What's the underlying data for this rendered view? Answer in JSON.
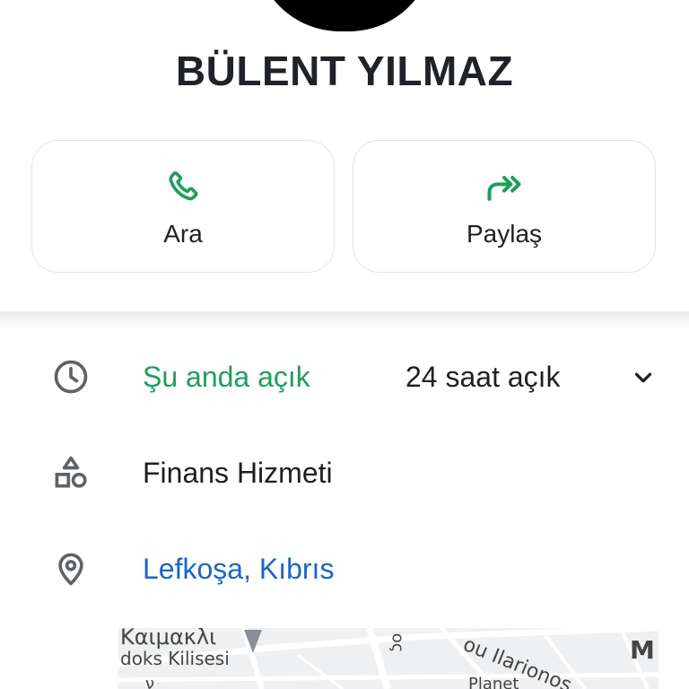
{
  "profile": {
    "name": "BÜLENT YILMAZ"
  },
  "actions": {
    "call_label": "Ara",
    "share_label": "Paylaş"
  },
  "info": {
    "open_status": "Şu anda açık",
    "hours": "24 saat açık",
    "category": "Finans Hizmeti",
    "location": "Lefkoşa, Kıbrıs"
  },
  "map": {
    "label_kaimakli": "Καιμακλι",
    "label_kilisesi": "doks Kilisesi",
    "label_ilarionos": "ou Ilarionos",
    "label_ios": "ος",
    "label_m": "M",
    "label_bottom1": "ν",
    "label_bottom2": "Planet"
  },
  "colors": {
    "accent_green": "#1e9f5a",
    "link_blue": "#1a66c6",
    "icon_gray": "#5f6368"
  },
  "icons": {
    "call": "phone-icon",
    "share": "share-forward-icon",
    "hours": "clock-icon",
    "category": "shapes-icon",
    "location": "location-pin-icon",
    "expand": "chevron-down-icon"
  }
}
